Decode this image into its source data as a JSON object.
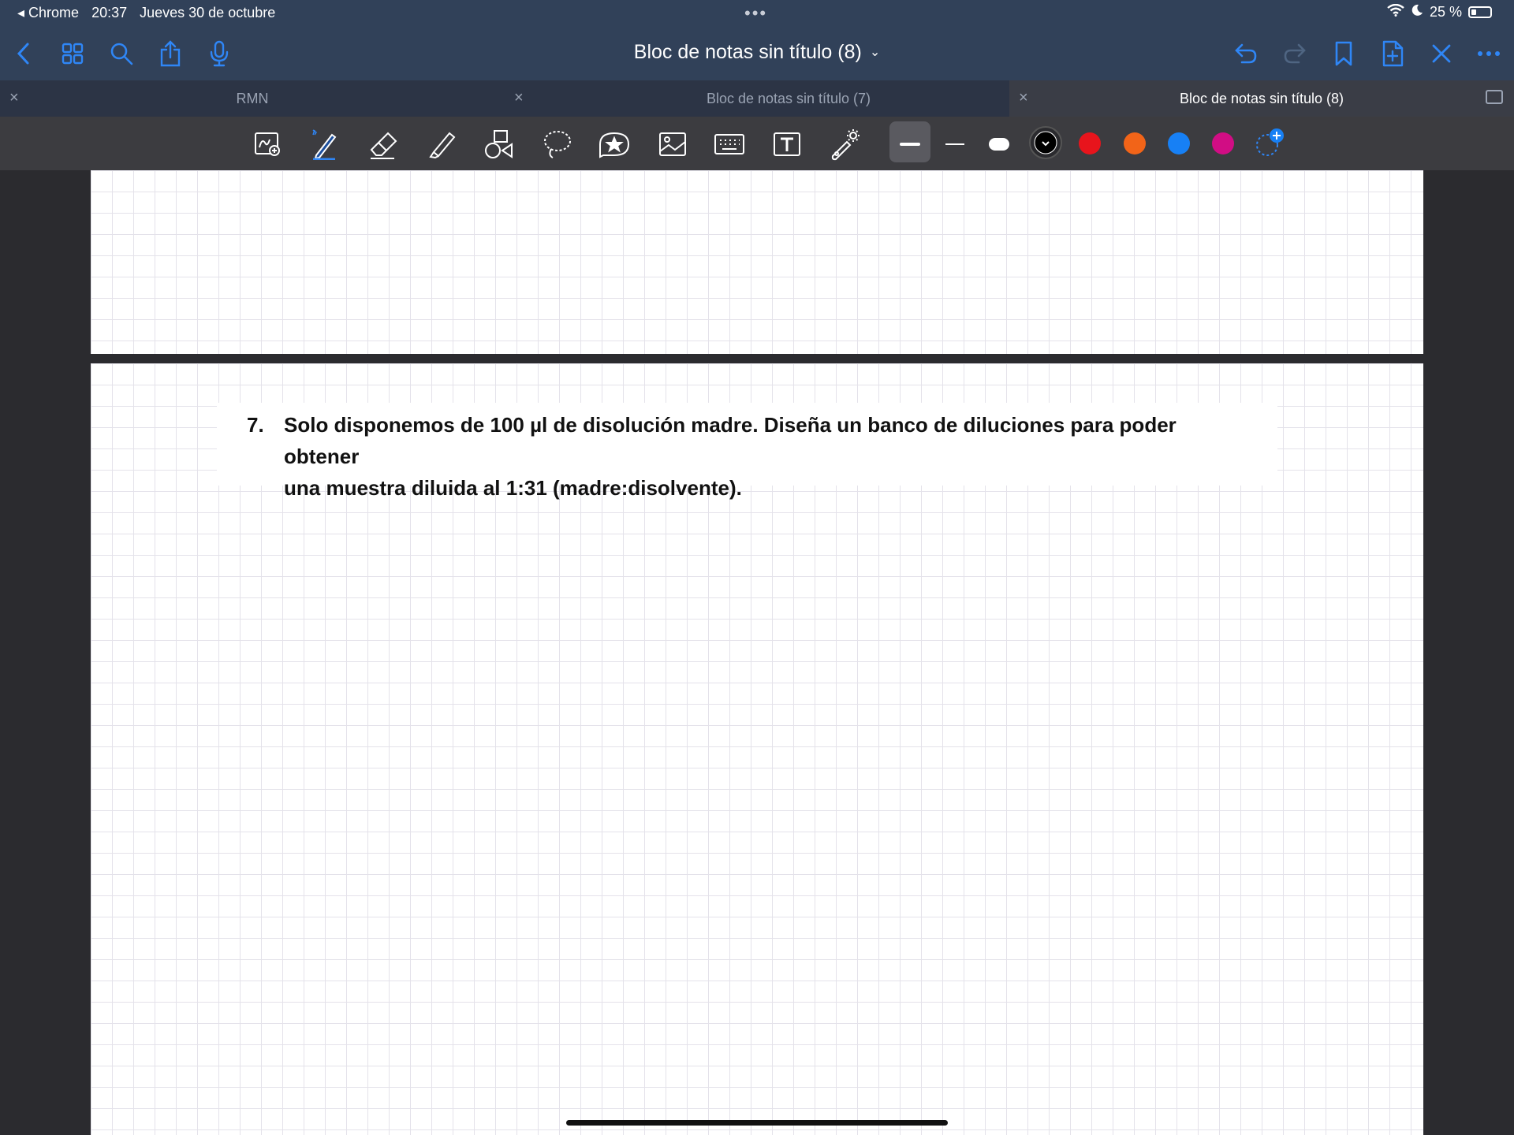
{
  "status_bar": {
    "back_app": "◂ Chrome",
    "time": "20:37",
    "date": "Jueves 30 de octubre",
    "dots": "•••",
    "battery": "25 %"
  },
  "nav": {
    "title": "Bloc de notas sin título (8)",
    "chevron": "⌄"
  },
  "tabs": [
    {
      "label": "RMN",
      "active": false
    },
    {
      "label": "Bloc de notas sin título (7)",
      "active": false
    },
    {
      "label": "Bloc de notas sin título (8)",
      "active": true
    }
  ],
  "toolbar": {
    "tools": [
      "zoom-window-tool",
      "pen-tool",
      "eraser-tool",
      "highlighter-tool",
      "shapes-tool",
      "lasso-tool",
      "sticker-tool",
      "image-tool",
      "keyboard-tool",
      "text-tool",
      "laser-pointer-tool"
    ],
    "stroke_widths": [
      "thick",
      "thin",
      "round"
    ],
    "colors": [
      "#000000",
      "#e8141c",
      "#f26418",
      "#1780f5",
      "#d10d84"
    ]
  },
  "document": {
    "question_number": "7.",
    "question_line1": "Solo disponemos de 100 µl de disolución madre. Diseña un banco de diluciones para poder obtener",
    "question_line2": "una muestra diluida al 1:31 (madre:disolvente)."
  }
}
